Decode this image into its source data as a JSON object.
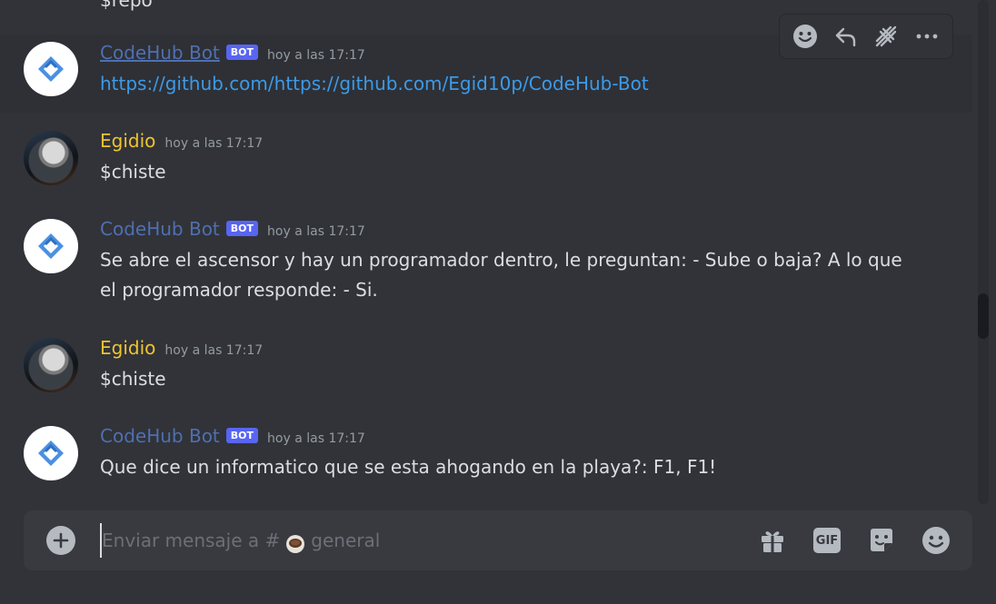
{
  "chat": {
    "partial_top_text": "$repo",
    "messages": [
      {
        "author": "CodeHub Bot",
        "bot_tag": "BOT",
        "timestamp": "hoy a las 17:17",
        "content": "https://github.com/https://github.com/Egid10p/CodeHub-Bot"
      },
      {
        "author": "Egidio",
        "timestamp": "hoy a las 17:17",
        "content": "$chiste"
      },
      {
        "author": "CodeHub Bot",
        "bot_tag": "BOT",
        "timestamp": "hoy a las 17:17",
        "content_line1": "Se abre el ascensor y hay un programador dentro, le preguntan: - Sube o baja? A lo que",
        "content_line2": "el programador responde: - Si."
      },
      {
        "author": "Egidio",
        "timestamp": "hoy a las 17:17",
        "content": "$chiste"
      },
      {
        "author": "CodeHub Bot",
        "bot_tag": "BOT",
        "timestamp": "hoy a las 17:17",
        "content": "Que dice un informatico que se esta ahogando en la playa?: F1, F1!"
      }
    ]
  },
  "hover_toolbar": {
    "icons": [
      "emoji-reaction-icon",
      "reply-icon",
      "create-thread-icon",
      "more-options-icon"
    ]
  },
  "composer": {
    "placeholder_prefix": "Enviar mensaje a #",
    "channel_name": "general",
    "icons": [
      "add-attachment-icon",
      "gift-icon",
      "gif-icon",
      "sticker-icon",
      "emoji-icon"
    ],
    "gif_label": "GIF"
  },
  "colors": {
    "background": "#313338",
    "bot_name": "#4f6fb0",
    "egidio_name": "#f0c430",
    "bot_tag": "#5865f2",
    "link": "#3d9ae8"
  }
}
